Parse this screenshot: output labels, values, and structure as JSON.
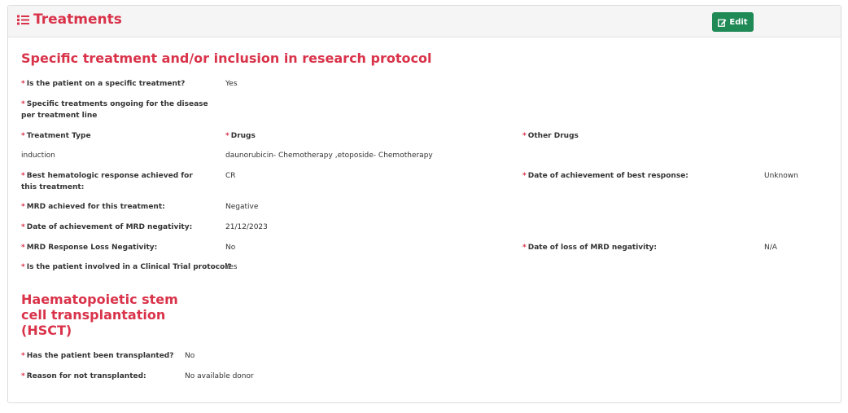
{
  "panel": {
    "title": "Treatments",
    "edit_label": "Edit"
  },
  "colors": {
    "accent": "#d9334a",
    "button": "#1f8a56"
  },
  "icons": {
    "header": "list-icon",
    "edit": "edit-icon"
  },
  "section1": {
    "title": "Specific treatment and/or inclusion in research protocol",
    "specific_treatment": {
      "label": "Is the patient on a specific treatment?",
      "value": "Yes"
    },
    "ongoing_label": "Specific treatments ongoing for the disease per treatment line",
    "columns": {
      "type": "Treatment Type",
      "drugs": "Drugs",
      "other": "Other Drugs"
    },
    "row": {
      "type": "induction",
      "drugs": "daunorubicin- Chemotherapy ,etoposide- Chemotherapy",
      "other": ""
    },
    "best_response": {
      "label": "Best hematologic response achieved for this treatment:",
      "value": "CR"
    },
    "best_response_date": {
      "label": "Date of achievement of best response:",
      "value": "Unknown"
    },
    "mrd": {
      "label": "MRD achieved for this treatment:",
      "value": "Negative"
    },
    "mrd_date": {
      "label": "Date of achievement of MRD negativity:",
      "value": "21/12/2023"
    },
    "mrd_loss": {
      "label": "MRD Response Loss Negativity:",
      "value": "No"
    },
    "mrd_loss_date": {
      "label": "Date of loss of MRD negativity:",
      "value": "N/A"
    },
    "clinical_trial": {
      "label": "Is the patient involved in a Clinical Trial protocol?",
      "value": "Yes"
    }
  },
  "section2": {
    "title": "Haematopoietic stem cell transplantation (HSCT)",
    "transplanted": {
      "label": "Has the patient been transplanted?",
      "value": "No"
    },
    "reason": {
      "label": "Reason for not transplanted:",
      "value": "No available donor"
    }
  }
}
